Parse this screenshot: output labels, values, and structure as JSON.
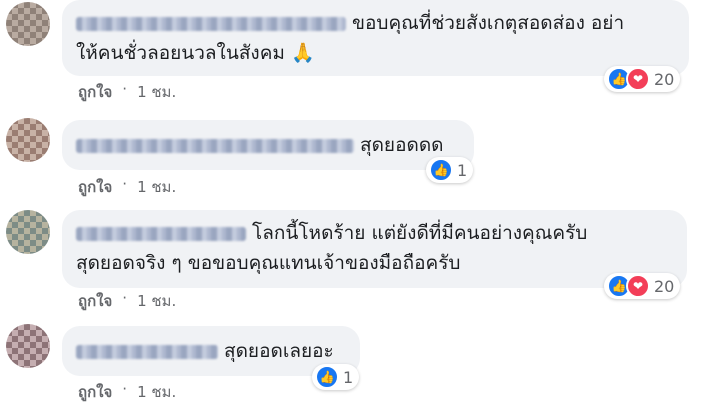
{
  "comments": [
    {
      "text": "ขอบคุณที่ช่วยสังเกตุสอดส่อง อย่า\nให้คนชั่วลอยนวลในสังคม 🙏",
      "reaction_count": "20",
      "reactions": [
        "like-icon",
        "love-icon"
      ],
      "like_label": "ถูกใจ",
      "separator": "·",
      "time": "1 ชม."
    },
    {
      "text": "สุดยอดดด",
      "reaction_count": "1",
      "reactions": [
        "like-icon"
      ],
      "like_label": "ถูกใจ",
      "separator": "·",
      "time": "1 ชม."
    },
    {
      "text": "โลกนี้โหดร้าย แต่ยังดีที่มีคนอย่างคุณครับ\nสุดยอดจริง ๆ ขอขอบคุณแทนเจ้าของมือถือครับ",
      "reaction_count": "20",
      "reactions": [
        "like-icon",
        "love-icon"
      ],
      "like_label": "ถูกใจ",
      "separator": "·",
      "time": "1 ชม."
    },
    {
      "text": "สุดยอดเลยอะ",
      "reaction_count": "1",
      "reactions": [
        "like-icon"
      ],
      "like_label": "ถูกใจ",
      "separator": "·",
      "time": "1 ชม."
    }
  ],
  "colors": {
    "bubble": "#f0f2f5",
    "like": "#1877f2",
    "love": "#f33e58",
    "meta": "#65676b"
  }
}
